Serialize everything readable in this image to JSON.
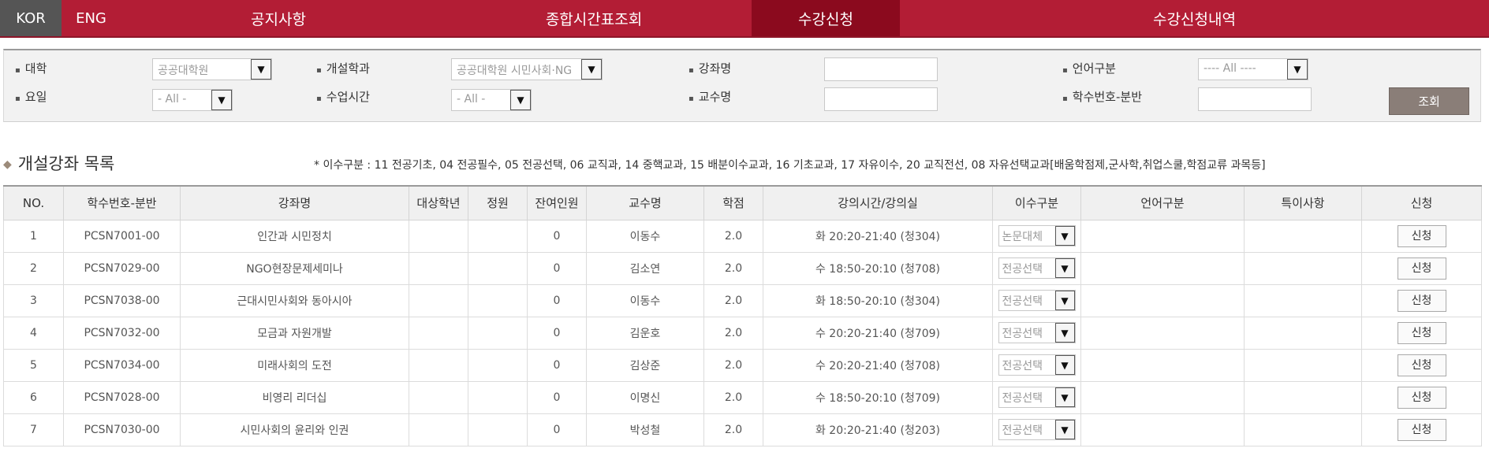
{
  "nav": {
    "lang_kor": "KOR",
    "lang_eng": "ENG",
    "items": [
      {
        "label": "공지사항",
        "active": false
      },
      {
        "label": "종합시간표조회",
        "active": false
      },
      {
        "label": "수강신청",
        "active": true
      },
      {
        "label": "수강신청내역",
        "active": false
      }
    ]
  },
  "filter": {
    "college_label": "대학",
    "college_value": "공공대학원",
    "dept_label": "개설학과",
    "dept_value": "공공대학원 시민사회·NG",
    "course_label": "강좌명",
    "course_value": "",
    "language_label": "언어구분",
    "language_value": "---- All ----",
    "day_label": "요일",
    "day_value": "- All -",
    "time_label": "수업시간",
    "time_value": "- All -",
    "prof_label": "교수명",
    "prof_value": "",
    "code_label": "학수번호-분반",
    "code_value": "",
    "search_label": "조회"
  },
  "section": {
    "title": "개설강좌 목록",
    "legend": "* 이수구분 : 11 전공기초, 04 전공필수, 05 전공선택, 06 교직과, 14 중핵교과, 15 배분이수교과, 16 기초교과, 17 자유이수, 20 교직전선, 08 자유선택교과[배움학점제,군사학,취업스쿨,학점교류 과목등]"
  },
  "table": {
    "headers": [
      "NO.",
      "학수번호-분반",
      "강좌명",
      "대상학년",
      "정원",
      "잔여인원",
      "교수명",
      "학점",
      "강의시간/강의실",
      "이수구분",
      "언어구분",
      "특이사항",
      "신청"
    ],
    "rows": [
      {
        "no": "1",
        "code": "PCSN7001-00",
        "name": "인간과 시민정치",
        "year": "",
        "cap": "",
        "remain": "0",
        "prof": "이동수",
        "credit": "2.0",
        "time": "화 20:20-21:40 (청304)",
        "type": "논문대체",
        "lang": "",
        "note": "",
        "apply": "신청"
      },
      {
        "no": "2",
        "code": "PCSN7029-00",
        "name": "NGO현장문제세미나",
        "year": "",
        "cap": "",
        "remain": "0",
        "prof": "김소연",
        "credit": "2.0",
        "time": "수 18:50-20:10 (청708)",
        "type": "전공선택",
        "lang": "",
        "note": "",
        "apply": "신청"
      },
      {
        "no": "3",
        "code": "PCSN7038-00",
        "name": "근대시민사회와 동아시아",
        "year": "",
        "cap": "",
        "remain": "0",
        "prof": "이동수",
        "credit": "2.0",
        "time": "화 18:50-20:10 (청304)",
        "type": "전공선택",
        "lang": "",
        "note": "",
        "apply": "신청"
      },
      {
        "no": "4",
        "code": "PCSN7032-00",
        "name": "모금과 자원개발",
        "year": "",
        "cap": "",
        "remain": "0",
        "prof": "김운호",
        "credit": "2.0",
        "time": "수 20:20-21:40 (청709)",
        "type": "전공선택",
        "lang": "",
        "note": "",
        "apply": "신청"
      },
      {
        "no": "5",
        "code": "PCSN7034-00",
        "name": "미래사회의 도전",
        "year": "",
        "cap": "",
        "remain": "0",
        "prof": "김상준",
        "credit": "2.0",
        "time": "수 20:20-21:40 (청708)",
        "type": "전공선택",
        "lang": "",
        "note": "",
        "apply": "신청"
      },
      {
        "no": "6",
        "code": "PCSN7028-00",
        "name": "비영리 리더십",
        "year": "",
        "cap": "",
        "remain": "0",
        "prof": "이명신",
        "credit": "2.0",
        "time": "수 18:50-20:10 (청709)",
        "type": "전공선택",
        "lang": "",
        "note": "",
        "apply": "신청"
      },
      {
        "no": "7",
        "code": "PCSN7030-00",
        "name": "시민사회의 윤리와 인권",
        "year": "",
        "cap": "",
        "remain": "0",
        "prof": "박성철",
        "credit": "2.0",
        "time": "화 20:20-21:40 (청203)",
        "type": "전공선택",
        "lang": "",
        "note": "",
        "apply": "신청"
      }
    ]
  },
  "colors": {
    "nav_bg": "#b31d35",
    "nav_active": "#8b0a1e",
    "lang_active": "#555555",
    "search_button": "#8a7e78"
  },
  "icons": {
    "dropdown": "chevron-down-icon",
    "section_marker": "diamond-icon"
  }
}
